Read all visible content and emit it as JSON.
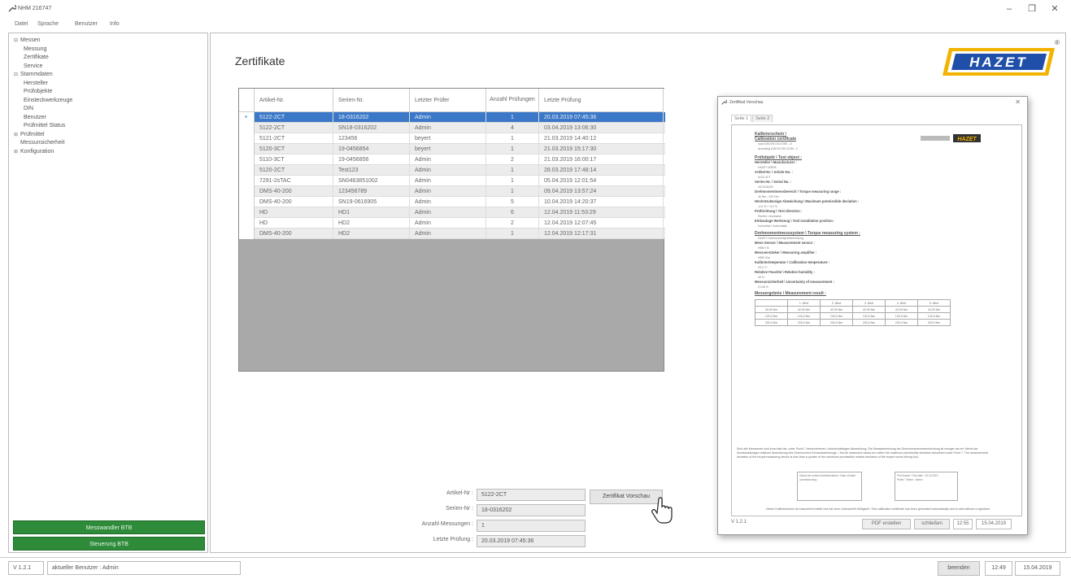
{
  "window": {
    "title": "NHM 216747",
    "icon": "wrench-icon",
    "minimize": "–",
    "maximize": "❐",
    "close": "✕"
  },
  "menu": [
    "Datei",
    "Sprache",
    "Benutzer",
    "Info"
  ],
  "sidebar": {
    "tree": [
      {
        "label": "Messen",
        "level": 0,
        "toggle": "⊟"
      },
      {
        "label": "Messung",
        "level": 1
      },
      {
        "label": "Zertifikate",
        "level": 1
      },
      {
        "label": "Service",
        "level": 1
      },
      {
        "label": "Stammdaten",
        "level": 0,
        "toggle": "⊟"
      },
      {
        "label": "Hersteller",
        "level": 1
      },
      {
        "label": "Prüfobjekte",
        "level": 1
      },
      {
        "label": "Einsteckwerkzeuge",
        "level": 1
      },
      {
        "label": "DIN",
        "level": 1
      },
      {
        "label": "Benutzer",
        "level": 1
      },
      {
        "label": "Prüfmittel Status",
        "level": 1
      },
      {
        "label": "Prüfmittel",
        "level": 0,
        "toggle": "⊞"
      },
      {
        "label": "Messunsicherheit",
        "level": 0
      },
      {
        "label": "Konfiguration",
        "level": 0,
        "toggle": "⊞"
      }
    ],
    "button_messwandler": "Messwandler BTB",
    "button_steuerung": "Steuerung BTB"
  },
  "main": {
    "title": "Zertifikate",
    "logo_text": "HAZET",
    "logo_registered": "®",
    "brand_color": "#f2b400"
  },
  "grid": {
    "columns": [
      "Artikel-Nr.",
      "Serien-Nr.",
      "Letzter Prüfer",
      "Anzahl Prüfungen",
      "Letzte Prüfung"
    ],
    "selected_marker": "▸",
    "rows": [
      [
        "5122-2CT",
        "18-0316202",
        "Admin",
        "1",
        "20.03.2019 07:45:36"
      ],
      [
        "5122-2CT",
        "SN18-0316202",
        "Admin",
        "4",
        "03.04.2019 13:06:30"
      ],
      [
        "5121-2CT",
        "123456",
        "beyert",
        "1",
        "21.03.2019 14:40:12"
      ],
      [
        "5120-3CT",
        "19-0456854",
        "beyert",
        "1",
        "21.03.2019 15:17:30"
      ],
      [
        "5110-3CT",
        "19-0456856",
        "Admin",
        "2",
        "21.03.2019 16:00:17"
      ],
      [
        "5120-2CT",
        "Test123",
        "Admin",
        "1",
        "28.03.2019 17:48:14"
      ],
      [
        "7291-2sTAC",
        "SN0463851002",
        "Admin",
        "1",
        "05.04.2019 12:01:54"
      ],
      [
        "DMS-40-200",
        "123456789",
        "Admin",
        "1",
        "09.04.2019 13:57:24"
      ],
      [
        "DMS-40-200",
        "SN19-0616905",
        "Admin",
        "5",
        "10.04.2019 14:20:37"
      ],
      [
        "HD",
        "HD1",
        "Admin",
        "6",
        "12.04.2019 11:53:29"
      ],
      [
        "HD",
        "HD2",
        "Admin",
        "2",
        "12.04.2019 12:07:45"
      ],
      [
        "DMS-40-200",
        "HD2",
        "Admin",
        "1",
        "12.04.2019 12:17:31"
      ]
    ]
  },
  "details": {
    "artikel_label": "Artikel-Nr :",
    "artikel_value": "5122-2CT",
    "serien_label": "Serien-Nr :",
    "serien_value": "18-0316202",
    "anzahl_label": "Anzahl Messungen :",
    "anzahl_value": "1",
    "letzte_label": "Letzte Prüfung :",
    "letzte_value": "20.03.2019 07:45:36",
    "preview_button": "Zertifikat Vorschau"
  },
  "preview": {
    "title": "Zertifikat Vorschau",
    "close": "✕",
    "tabs": [
      "Seite 1",
      "Seite 2"
    ],
    "doc": {
      "heading1": "Kalibrierschein \\",
      "heading2": "Calibration certificate",
      "sub1": "nach DIN EN ISO 6789 - 2/",
      "sub2": "according DIN EN ISO 6789 - 2",
      "logo_text": "HAZET",
      "section_object": "Prüfobjekt \\ Test object :",
      "manufacturer_label": "Hersteller \\ Manufacturer :",
      "manufacturer_value": "HAZET-WERK",
      "article_label": "Artikel-Nr. \\ Article No. :",
      "article_value": "5122-2CT",
      "serial_label": "Serien-Nr. \\ Serial No. :",
      "serial_value": "18-0316202",
      "range_label": "Drehmomentmessbereich \\ Torque measuring range :",
      "range_value": "40 Nm - 200 Nm",
      "deviation_label": "Höchstzulässige Abweichung \\ Maximum permissible deviation :",
      "deviation_value": "-4,0 % / +4,0 %",
      "direction_label": "Prüfrichtung \\ Test direction :",
      "direction_value": "Rechts \\ clockwise",
      "install_label": "Einbaulage Werkzeug \\ Tool installation position :",
      "install_value": "horizontal \\ horizontally",
      "section_system": "Drehmomentmesssystem \\ Torque measuring system :",
      "system_value": "HAZET Drehmomentprüfeinrichtung",
      "sensor_label": "Mess-Sensor \\ Measurement sensor :",
      "sensor_value": "HBM T5/",
      "amp_label": "Messverstärker \\ Measuring amplifier :",
      "amp_value": "HBM Clip",
      "temp_label": "Kalibriertemperatur \\ Calibration temperature :",
      "temp_value": "23,3 °C",
      "hum_label": "Relative Feuchte \\ Relative humidity :",
      "hum_value": "45 %",
      "unc_label": "Messunsicherheit \\ Uncertainty of measurement :",
      "unc_value": "0,136 %",
      "section_result": "Messergebnis \\ Measurement result :",
      "result_header": [
        "",
        "1. Wert",
        "2. Wert",
        "3. Wert",
        "4. Wert",
        "5. Wert"
      ],
      "result_rows": [
        [
          "40,00 Nm",
          "42,00 Nm",
          "42,03 Nm",
          "42,00 Nm",
          "42,00 Nm",
          "42,00 Nm"
        ],
        [
          "120,0 Nm",
          "124,0 Nm",
          "124,0 Nm",
          "124,0 Nm",
          "124,0 Nm",
          "124,0 Nm"
        ],
        [
          "200,0 Nm",
          "203,0 Nm",
          "203,0 Nm",
          "203,0 Nm",
          "203,4 Nm",
          "203,0 Nm"
        ]
      ],
      "note": "Sind alle Messwerte sind innerhalb der, unter Punkt 7 beschriebenen, höchstzulässigen Abweichung. Die Messabweichung der Drehmomentmesseinrichtung ist weniger als ein Viertel der höchstzulässigen relativen Abweichung des Drehmoment-Schraubwerkzeugs. \\ Not all measured values are within the maximum permissible deviation described under Point 7. The measurement deviation of the torque measuring device is less than a quarter of the maximum permissible relative deviation of the torque screw driving tool.",
      "sig_left": "Datum der ersten Inbetriebnahme \\ Date of initial commissioning :",
      "sig_right_date_label": "Prüf-Datum \\ Test date :",
      "sig_right_date_value": "20.03.2019",
      "sig_right_tester_label": "Prüfer \\ Tester :",
      "sig_right_tester_value": "Admin",
      "footer": "Dieser Kalibrierschein ist maschinell erstellt und hat ohne Unterschrift Gültigkeit \\ This calibration certificate has been generated automatically and is valid without a signature."
    },
    "version": "V 1.2.1",
    "pdf_button": "PDF erstellen",
    "close_button": "schließen",
    "time": "12:55",
    "date": "15.04.2019"
  },
  "statusbar": {
    "version": "V 1.2.1",
    "user": "aktueller Benutzer : Admin",
    "exit_button": "beenden",
    "time": "12:49",
    "date": "15.04.2019"
  }
}
